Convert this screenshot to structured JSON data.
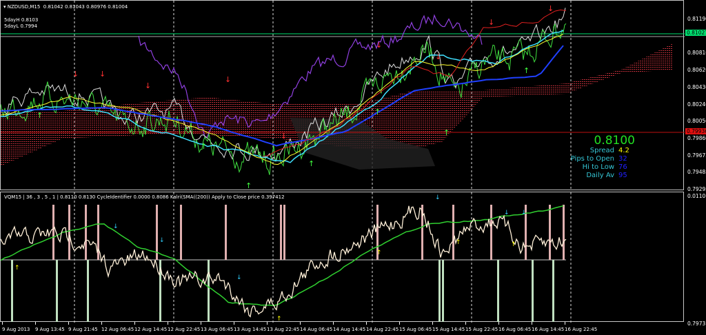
{
  "chart": {
    "symbol_header": "NZDUSD,M15",
    "ohlc": "0.81042 0.81043 0.80976 0.81004",
    "five_day_high": "5dayH 0.8103",
    "five_day_low": "5dayL 0.7994"
  },
  "price_axis": {
    "labels": [
      "0.81190",
      "0.80810",
      "0.80620",
      "0.80430",
      "0.80240",
      "0.80050",
      "0.79860",
      "0.79675",
      "0.79485",
      "0.79295"
    ],
    "current_price": "0.81027",
    "current_price_color": "#00e070",
    "low_line_price": "0.79936",
    "low_line_color": "#e01010"
  },
  "info_panel": {
    "price": "0.8100",
    "rows": [
      {
        "label": "Spread",
        "value": "4.2",
        "color": "#ffff00"
      },
      {
        "label": "Pips to Open",
        "value": "32",
        "color": "#2020ff"
      },
      {
        "label": "Hi to Low",
        "value": "76",
        "color": "#2020ff"
      },
      {
        "label": "Daily Av",
        "value": "95",
        "color": "#2020ff"
      }
    ]
  },
  "indicator": {
    "header": "VQM15 | 36 , 3 , 5 , 1 | 0.8110 0.8130 CycleIdentifier 0.0000 0.8086 Kalri(SMA((200)) Apply to Close price 0.397412",
    "axis_top": "0.0110",
    "axis_bottom": "0.7973"
  },
  "time_axis": [
    "9 Aug 2013",
    "9 Aug 13:45",
    "9 Aug 21:45",
    "12 Aug 06:45",
    "12 Aug 14:45",
    "12 Aug 22:45",
    "13 Aug 06:45",
    "13 Aug 14:45",
    "13 Aug 22:45",
    "14 Aug 06:45",
    "14 Aug 14:45",
    "14 Aug 22:45",
    "15 Aug 06:45",
    "15 Aug 14:45",
    "15 Aug 22:45",
    "16 Aug 06:45",
    "16 Aug 14:45",
    "16 Aug 22:45"
  ]
}
